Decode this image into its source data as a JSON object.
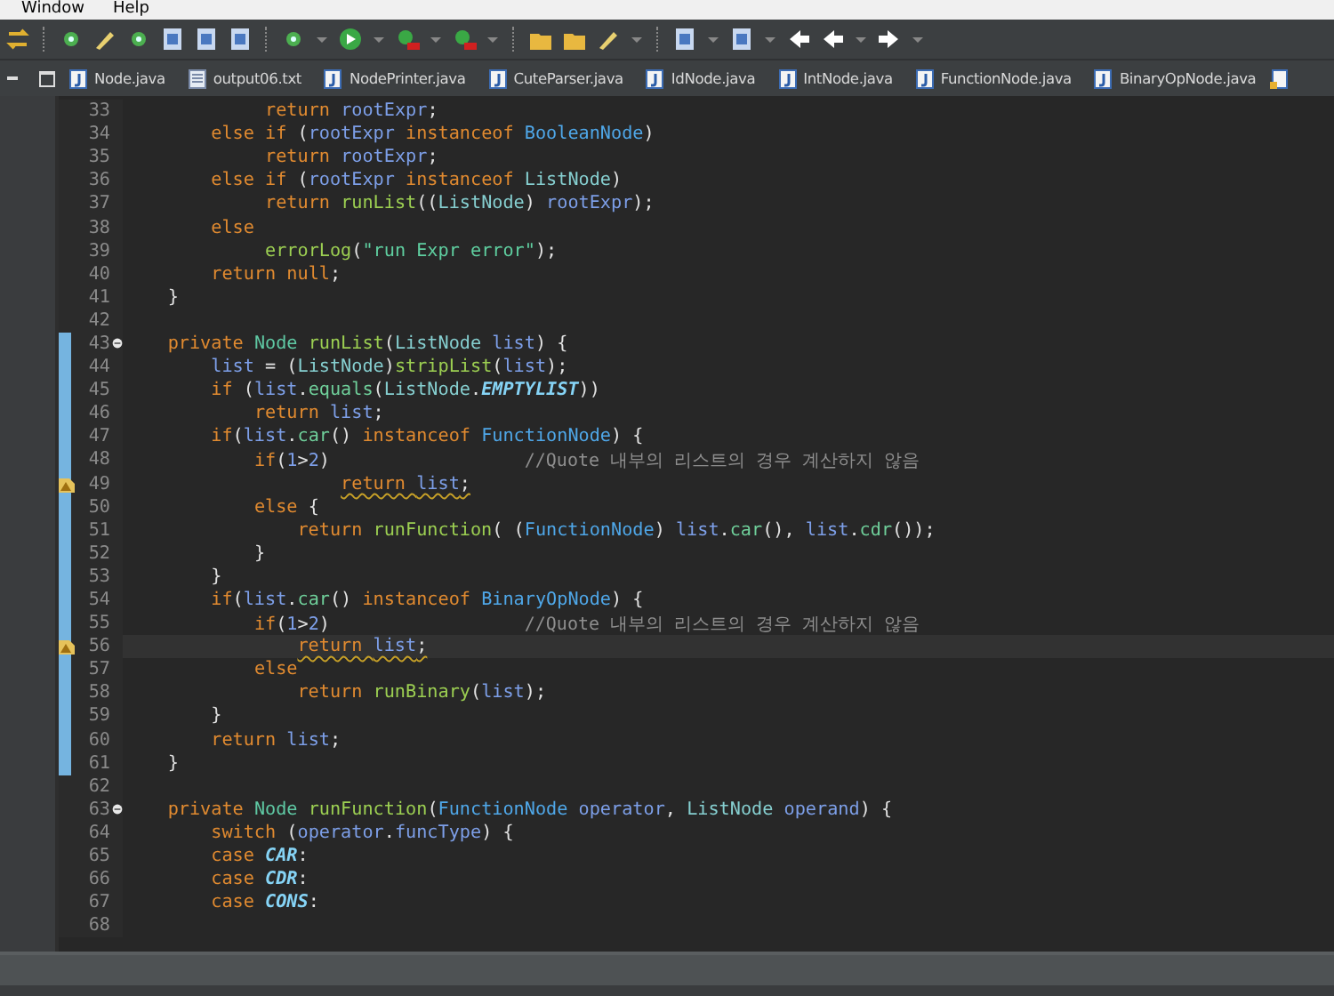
{
  "menu": [
    "Window",
    "Help"
  ],
  "tabs": [
    {
      "label": "Node.java",
      "kind": "java",
      "selected": false
    },
    {
      "label": "output06.txt",
      "kind": "text",
      "selected": false
    },
    {
      "label": "NodePrinter.java",
      "kind": "java",
      "selected": false
    },
    {
      "label": "CuteParser.java",
      "kind": "java",
      "selected": false
    },
    {
      "label": "IdNode.java",
      "kind": "java",
      "selected": false
    },
    {
      "label": "IntNode.java",
      "kind": "java",
      "selected": false
    },
    {
      "label": "FunctionNode.java",
      "kind": "java",
      "selected": false
    },
    {
      "label": "BinaryOpNode.java",
      "kind": "java",
      "selected": false
    }
  ],
  "lines": [
    {
      "number": "33",
      "changed": false,
      "fold": false,
      "warning": false,
      "current": false,
      "tokens": [
        {
          "kind": "kw",
          "text": "             return "
        },
        {
          "kind": "var",
          "text": "rootExpr"
        },
        {
          "kind": "plain",
          "text": ";"
        }
      ]
    },
    {
      "number": "34",
      "changed": false,
      "fold": false,
      "warning": false,
      "current": false,
      "tokens": [
        {
          "kind": "kw",
          "text": "        else if "
        },
        {
          "kind": "plain",
          "text": "("
        },
        {
          "kind": "var",
          "text": "rootExpr "
        },
        {
          "kind": "kw",
          "text": "instanceof "
        },
        {
          "kind": "type",
          "text": "BooleanNode"
        },
        {
          "kind": "plain",
          "text": ")"
        }
      ]
    },
    {
      "number": "35",
      "changed": false,
      "fold": false,
      "warning": false,
      "current": false,
      "tokens": [
        {
          "kind": "kw",
          "text": "             return "
        },
        {
          "kind": "var",
          "text": "rootExpr"
        },
        {
          "kind": "plain",
          "text": ";"
        }
      ]
    },
    {
      "number": "36",
      "changed": false,
      "fold": false,
      "warning": false,
      "current": false,
      "tokens": [
        {
          "kind": "kw",
          "text": "        else if "
        },
        {
          "kind": "plain",
          "text": "("
        },
        {
          "kind": "var",
          "text": "rootExpr "
        },
        {
          "kind": "kw",
          "text": "instanceof "
        },
        {
          "kind": "cls",
          "text": "ListNode"
        },
        {
          "kind": "plain",
          "text": ")"
        }
      ]
    },
    {
      "number": "37",
      "changed": false,
      "fold": false,
      "warning": false,
      "current": false,
      "tokens": [
        {
          "kind": "kw",
          "text": "             return "
        },
        {
          "kind": "fn",
          "text": "runList"
        },
        {
          "kind": "plain",
          "text": "(("
        },
        {
          "kind": "cls",
          "text": "ListNode"
        },
        {
          "kind": "plain",
          "text": ") "
        },
        {
          "kind": "var",
          "text": "rootExpr"
        },
        {
          "kind": "plain",
          "text": ");"
        }
      ]
    },
    {
      "number": "38",
      "changed": false,
      "fold": false,
      "warning": false,
      "current": false,
      "tokens": [
        {
          "kind": "kw",
          "text": "        else"
        }
      ]
    },
    {
      "number": "39",
      "changed": false,
      "fold": false,
      "warning": false,
      "current": false,
      "tokens": [
        {
          "kind": "fn",
          "text": "             errorLog"
        },
        {
          "kind": "plain",
          "text": "("
        },
        {
          "kind": "str",
          "text": "\"run Expr error\""
        },
        {
          "kind": "plain",
          "text": ");"
        }
      ]
    },
    {
      "number": "40",
      "changed": false,
      "fold": false,
      "warning": false,
      "current": false,
      "tokens": [
        {
          "kind": "kw",
          "text": "        return null"
        },
        {
          "kind": "plain",
          "text": ";"
        }
      ]
    },
    {
      "number": "41",
      "changed": false,
      "fold": false,
      "warning": false,
      "current": false,
      "tokens": [
        {
          "kind": "plain",
          "text": "    }"
        }
      ]
    },
    {
      "number": "42",
      "changed": false,
      "fold": false,
      "warning": false,
      "current": false
    },
    {
      "number": "43",
      "changed": true,
      "fold": true,
      "warning": false,
      "current": false,
      "tokens": [
        {
          "kind": "kw",
          "text": "    private "
        },
        {
          "kind": "cls2",
          "text": "Node "
        },
        {
          "kind": "fn",
          "text": "runList"
        },
        {
          "kind": "plain",
          "text": "("
        },
        {
          "kind": "cls",
          "text": "ListNode "
        },
        {
          "kind": "var",
          "text": "list"
        },
        {
          "kind": "plain",
          "text": ") {"
        }
      ]
    },
    {
      "number": "44",
      "changed": true,
      "fold": false,
      "warning": false,
      "current": false,
      "tokens": [
        {
          "kind": "var",
          "text": "        list "
        },
        {
          "kind": "plain",
          "text": "= ("
        },
        {
          "kind": "cls",
          "text": "ListNode"
        },
        {
          "kind": "plain",
          "text": ")"
        },
        {
          "kind": "fn",
          "text": "stripList"
        },
        {
          "kind": "plain",
          "text": "("
        },
        {
          "kind": "var",
          "text": "list"
        },
        {
          "kind": "plain",
          "text": ");"
        }
      ]
    },
    {
      "number": "45",
      "changed": true,
      "fold": false,
      "warning": false,
      "current": false,
      "tokens": [
        {
          "kind": "kw",
          "text": "        if "
        },
        {
          "kind": "plain",
          "text": "("
        },
        {
          "kind": "var",
          "text": "list"
        },
        {
          "kind": "plain",
          "text": "."
        },
        {
          "kind": "method",
          "text": "equals"
        },
        {
          "kind": "plain",
          "text": "("
        },
        {
          "kind": "cls",
          "text": "ListNode"
        },
        {
          "kind": "plain",
          "text": "."
        },
        {
          "kind": "const",
          "text": "EMPTYLIST"
        },
        {
          "kind": "plain",
          "text": "))"
        }
      ]
    },
    {
      "number": "46",
      "changed": true,
      "fold": false,
      "warning": false,
      "current": false,
      "tokens": [
        {
          "kind": "kw",
          "text": "            return "
        },
        {
          "kind": "var",
          "text": "list"
        },
        {
          "kind": "plain",
          "text": ";"
        }
      ]
    },
    {
      "number": "47",
      "changed": true,
      "fold": false,
      "warning": false,
      "current": false,
      "tokens": [
        {
          "kind": "kw",
          "text": "        if"
        },
        {
          "kind": "plain",
          "text": "("
        },
        {
          "kind": "var",
          "text": "list"
        },
        {
          "kind": "plain",
          "text": "."
        },
        {
          "kind": "method",
          "text": "car"
        },
        {
          "kind": "plain",
          "text": "() "
        },
        {
          "kind": "kw",
          "text": "instanceof "
        },
        {
          "kind": "type",
          "text": "FunctionNode"
        },
        {
          "kind": "plain",
          "text": ") {"
        }
      ]
    },
    {
      "number": "48",
      "changed": true,
      "fold": false,
      "warning": false,
      "current": false,
      "tokens": [
        {
          "kind": "kw",
          "text": "            if"
        },
        {
          "kind": "plain",
          "text": "("
        },
        {
          "kind": "num",
          "text": "1"
        },
        {
          "kind": "plain",
          "text": ">"
        },
        {
          "kind": "num",
          "text": "2"
        },
        {
          "kind": "plain",
          "text": ")                  "
        },
        {
          "kind": "cmt",
          "text": "//Quote 내부의 리스트의 경우 계산하지 않음"
        }
      ]
    },
    {
      "number": "49",
      "changed": true,
      "fold": false,
      "warning": true,
      "current": false,
      "tokens": [
        {
          "kind": "kw",
          "text": "                    return "
        },
        {
          "kind": "var",
          "text": "list"
        },
        {
          "kind": "plain",
          "text": ";"
        }
      ]
    },
    {
      "number": "50",
      "changed": true,
      "fold": false,
      "warning": false,
      "current": false,
      "tokens": [
        {
          "kind": "kw",
          "text": "            else "
        },
        {
          "kind": "plain",
          "text": "{"
        }
      ]
    },
    {
      "number": "51",
      "changed": true,
      "fold": false,
      "warning": false,
      "current": false,
      "tokens": [
        {
          "kind": "kw",
          "text": "                return "
        },
        {
          "kind": "fn",
          "text": "runFunction"
        },
        {
          "kind": "plain",
          "text": "( ("
        },
        {
          "kind": "type",
          "text": "FunctionNode"
        },
        {
          "kind": "plain",
          "text": ") "
        },
        {
          "kind": "var",
          "text": "list"
        },
        {
          "kind": "plain",
          "text": "."
        },
        {
          "kind": "method",
          "text": "car"
        },
        {
          "kind": "plain",
          "text": "(), "
        },
        {
          "kind": "var",
          "text": "list"
        },
        {
          "kind": "plain",
          "text": "."
        },
        {
          "kind": "method",
          "text": "cdr"
        },
        {
          "kind": "plain",
          "text": "());"
        }
      ]
    },
    {
      "number": "52",
      "changed": true,
      "fold": false,
      "warning": false,
      "current": false,
      "tokens": [
        {
          "kind": "plain",
          "text": "            }"
        }
      ]
    },
    {
      "number": "53",
      "changed": true,
      "fold": false,
      "warning": false,
      "current": false,
      "tokens": [
        {
          "kind": "plain",
          "text": "        }"
        }
      ]
    },
    {
      "number": "54",
      "changed": true,
      "fold": false,
      "warning": false,
      "current": false,
      "tokens": [
        {
          "kind": "kw",
          "text": "        if"
        },
        {
          "kind": "plain",
          "text": "("
        },
        {
          "kind": "var",
          "text": "list"
        },
        {
          "kind": "plain",
          "text": "."
        },
        {
          "kind": "method",
          "text": "car"
        },
        {
          "kind": "plain",
          "text": "() "
        },
        {
          "kind": "kw",
          "text": "instanceof "
        },
        {
          "kind": "type",
          "text": "BinaryOpNode"
        },
        {
          "kind": "plain",
          "text": ") {"
        }
      ]
    },
    {
      "number": "55",
      "changed": true,
      "fold": false,
      "warning": false,
      "current": false,
      "tokens": [
        {
          "kind": "kw",
          "text": "            if"
        },
        {
          "kind": "plain",
          "text": "("
        },
        {
          "kind": "num",
          "text": "1"
        },
        {
          "kind": "plain",
          "text": ">"
        },
        {
          "kind": "num",
          "text": "2"
        },
        {
          "kind": "plain",
          "text": ")                  "
        },
        {
          "kind": "cmt",
          "text": "//Quote 내부의 리스트의 경우 계산하지 않음"
        }
      ]
    },
    {
      "number": "56",
      "changed": true,
      "fold": false,
      "warning": true,
      "current": true,
      "tokens": [
        {
          "kind": "kw",
          "text": "                return "
        },
        {
          "kind": "var",
          "text": "list"
        },
        {
          "kind": "plain",
          "text": ";"
        }
      ]
    },
    {
      "number": "57",
      "changed": true,
      "fold": false,
      "warning": false,
      "current": false,
      "tokens": [
        {
          "kind": "kw",
          "text": "            else"
        }
      ]
    },
    {
      "number": "58",
      "changed": true,
      "fold": false,
      "warning": false,
      "current": false,
      "tokens": [
        {
          "kind": "kw",
          "text": "                return "
        },
        {
          "kind": "fn",
          "text": "runBinary"
        },
        {
          "kind": "plain",
          "text": "("
        },
        {
          "kind": "var",
          "text": "list"
        },
        {
          "kind": "plain",
          "text": ");"
        }
      ]
    },
    {
      "number": "59",
      "changed": true,
      "fold": false,
      "warning": false,
      "current": false,
      "tokens": [
        {
          "kind": "plain",
          "text": "        }"
        }
      ]
    },
    {
      "number": "60",
      "changed": true,
      "fold": false,
      "warning": false,
      "current": false,
      "tokens": [
        {
          "kind": "kw",
          "text": "        return "
        },
        {
          "kind": "var",
          "text": "list"
        },
        {
          "kind": "plain",
          "text": ";"
        }
      ]
    },
    {
      "number": "61",
      "changed": true,
      "fold": false,
      "warning": false,
      "current": false,
      "tokens": [
        {
          "kind": "plain",
          "text": "    }"
        }
      ]
    },
    {
      "number": "62",
      "changed": false,
      "fold": false,
      "warning": false,
      "current": false
    },
    {
      "number": "63",
      "changed": false,
      "fold": true,
      "warning": false,
      "current": false,
      "tokens": [
        {
          "kind": "kw",
          "text": "    private "
        },
        {
          "kind": "cls2",
          "text": "Node "
        },
        {
          "kind": "fn",
          "text": "runFunction"
        },
        {
          "kind": "plain",
          "text": "("
        },
        {
          "kind": "type",
          "text": "FunctionNode "
        },
        {
          "kind": "var",
          "text": "operator"
        },
        {
          "kind": "plain",
          "text": ", "
        },
        {
          "kind": "cls",
          "text": "ListNode "
        },
        {
          "kind": "var",
          "text": "operand"
        },
        {
          "kind": "plain",
          "text": ") {"
        }
      ]
    },
    {
      "number": "64",
      "changed": false,
      "fold": false,
      "warning": false,
      "current": false,
      "tokens": [
        {
          "kind": "kw",
          "text": "        switch "
        },
        {
          "kind": "plain",
          "text": "("
        },
        {
          "kind": "var",
          "text": "operator"
        },
        {
          "kind": "plain",
          "text": "."
        },
        {
          "kind": "var",
          "text": "funcType"
        },
        {
          "kind": "plain",
          "text": ") {"
        }
      ]
    },
    {
      "number": "65",
      "changed": false,
      "fold": false,
      "warning": false,
      "current": false,
      "tokens": [
        {
          "kind": "kw",
          "text": "        case "
        },
        {
          "kind": "const",
          "text": "CAR"
        },
        {
          "kind": "plain",
          "text": ":"
        }
      ]
    },
    {
      "number": "66",
      "changed": false,
      "fold": false,
      "warning": false,
      "current": false,
      "tokens": [
        {
          "kind": "kw",
          "text": "        case "
        },
        {
          "kind": "const",
          "text": "CDR"
        },
        {
          "kind": "plain",
          "text": ":"
        }
      ]
    },
    {
      "number": "67",
      "changed": false,
      "fold": false,
      "warning": false,
      "current": false,
      "tokens": [
        {
          "kind": "kw",
          "text": "        case "
        },
        {
          "kind": "const",
          "text": "CONS"
        },
        {
          "kind": "plain",
          "text": ":"
        }
      ]
    },
    {
      "number": "68",
      "changed": false,
      "fold": false,
      "warning": false,
      "current": false
    }
  ]
}
